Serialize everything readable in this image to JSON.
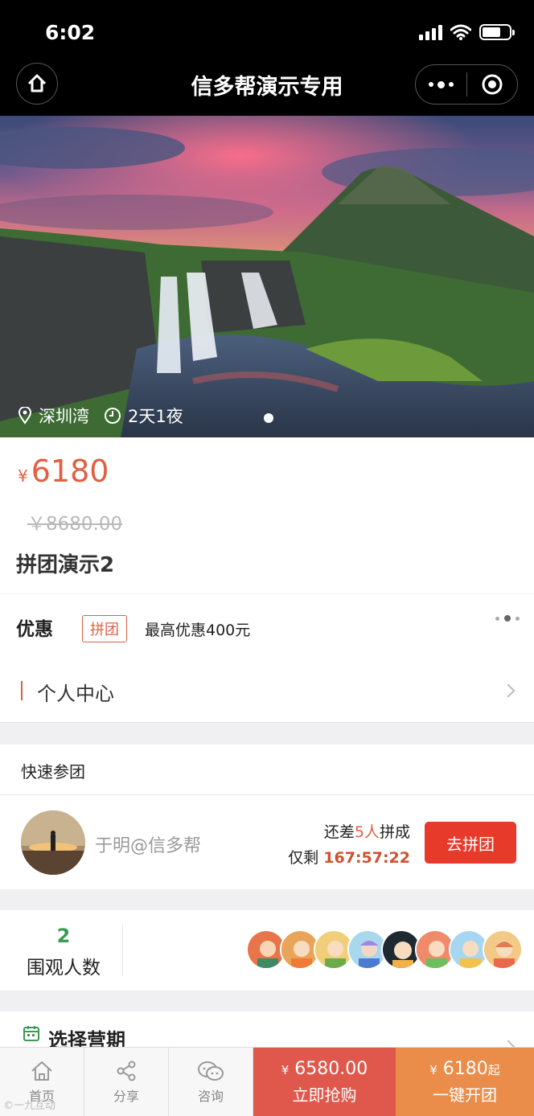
{
  "status_bar": {
    "time": "6:02"
  },
  "nav": {
    "title": "信多帮演示专用"
  },
  "hero": {
    "location": "深圳湾",
    "duration": "2天1夜"
  },
  "product": {
    "currency": "¥",
    "price": "6180",
    "original_price": "￥8680.00",
    "name": "拼团演示2"
  },
  "promo": {
    "label": "优惠",
    "tag": "拼团",
    "text": "最高优惠400元",
    "link": "个人中心"
  },
  "quick_join": {
    "title": "快速参团",
    "user_name": "于明@信多帮",
    "need_prefix": "还差",
    "need_count": "5人",
    "need_suffix": "拼成",
    "remain_prefix": "仅剩",
    "timer": "167:57:22",
    "button": "去拼团"
  },
  "viewers": {
    "count": "2",
    "label": "围观人数"
  },
  "camp": {
    "title": "选择营期"
  },
  "bottom_bar": {
    "home": "首页",
    "share": "分享",
    "consult": "咨询",
    "buy_currency": "¥",
    "buy_price": "6580.00",
    "buy_label": "立即抢购",
    "group_currency": "¥",
    "group_price": "6180",
    "group_suffix": "起",
    "group_label": "一键开团"
  },
  "watermark": "©一九互动"
}
